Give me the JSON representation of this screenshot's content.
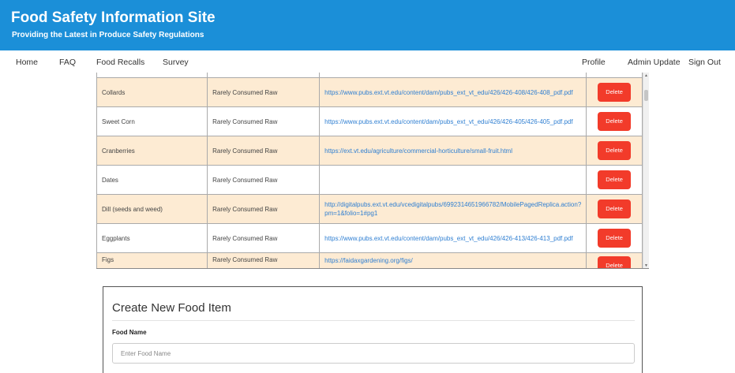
{
  "header": {
    "title": "Food Safety Information Site",
    "subtitle": "Providing the Latest in Produce Safety Regulations"
  },
  "nav": {
    "home": "Home",
    "faq": "FAQ",
    "food_recalls": "Food Recalls",
    "survey": "Survey",
    "profile": "Profile",
    "admin_update": "Admin Update",
    "sign_out": "Sign Out"
  },
  "table": {
    "delete_label": "Delete",
    "rows": [
      {
        "name": "",
        "category": "",
        "url": ""
      },
      {
        "name": "Collards",
        "category": "Rarely Consumed Raw",
        "url": "https://www.pubs.ext.vt.edu/content/dam/pubs_ext_vt_edu/426/426-408/426-408_pdf.pdf"
      },
      {
        "name": "Sweet Corn",
        "category": "Rarely Consumed Raw",
        "url": "https://www.pubs.ext.vt.edu/content/dam/pubs_ext_vt_edu/426/426-405/426-405_pdf.pdf"
      },
      {
        "name": "Cranberries",
        "category": "Rarely Consumed Raw",
        "url": "https://ext.vt.edu/agriculture/commercial-horticulture/small-fruit.html"
      },
      {
        "name": "Dates",
        "category": "Rarely Consumed Raw",
        "url": ""
      },
      {
        "name": "Dill (seeds and weed)",
        "category": "Rarely Consumed Raw",
        "url": "http://digitalpubs.ext.vt.edu/vcedigitalpubs/6992314651966782/MobilePagedReplica.action?pm=1&folio=1#pg1"
      },
      {
        "name": "Eggplants",
        "category": "Rarely Consumed Raw",
        "url": "https://www.pubs.ext.vt.edu/content/dam/pubs_ext_vt_edu/426/426-413/426-413_pdf.pdf"
      },
      {
        "name": "Figs",
        "category": "Rarely Consumed Raw",
        "url": "https://faidaxgardening.org/figs/"
      }
    ]
  },
  "form": {
    "title": "Create New Food Item",
    "food_name_label": "Food Name",
    "food_name_placeholder": "Enter Food Name"
  },
  "colors": {
    "header_bg": "#1b8fd8",
    "row_alt": "#fdebd3",
    "delete_button": "#f23b2a",
    "link": "#2f7fd2"
  }
}
